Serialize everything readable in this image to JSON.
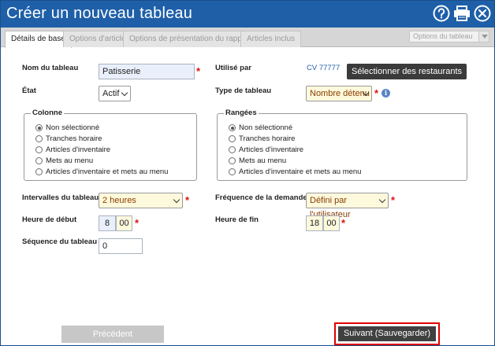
{
  "window": {
    "title": "Créer un nouveau tableau",
    "icons": [
      "help-icon",
      "print-icon",
      "close-icon"
    ]
  },
  "tabs": [
    {
      "label": "Détails de base",
      "active": true
    },
    {
      "label": "Options d'article",
      "active": false
    },
    {
      "label": "Options de présentation du rapport",
      "active": false
    },
    {
      "label": "Articles inclus",
      "active": false
    }
  ],
  "tab_options_select": "Options du tableau",
  "form": {
    "name_label": "Nom du tableau",
    "name_value": "Patisserie",
    "used_by_label": "Utilisé par",
    "used_by_value": "CV 77777",
    "select_restaurants_label": "Sélectionner des restaurants",
    "state_label": "État",
    "state_value": "Actif",
    "table_type_label": "Type de tableau",
    "table_type_value": "Nombre détenu",
    "interval_label": "Intervalles du tableau",
    "interval_value": "2 heures",
    "demand_label": "Fréquence de la demande",
    "demand_value": "Défini par l'utilisateur",
    "start_label": "Heure de début",
    "start_hour": "8",
    "start_min": "00",
    "end_label": "Heure de fin",
    "end_hour": "18",
    "end_min": "00",
    "sequence_label": "Séquence du tableau",
    "sequence_value": "0",
    "required_mark": "*",
    "info_glyph": "i"
  },
  "colonne": {
    "legend": "Colonne",
    "options": [
      "Non sélectionné",
      "Tranches horaire",
      "Articles d'inventaire",
      "Mets au menu",
      "Articles d'inventaire et mets au menu"
    ],
    "selected_index": 0
  },
  "rangees": {
    "legend": "Rangées",
    "options": [
      "Non sélectionné",
      "Tranches horaire",
      "Articles d'inventaire",
      "Mets au menu",
      "Articles d'inventaire et mets au menu"
    ],
    "selected_index": 0
  },
  "footer": {
    "prev_label": "Précédent",
    "next_label": "Suivant (Sauvegarder)"
  },
  "colors": {
    "title_bar": "#1e5fa8",
    "required": "#dd1111",
    "highlight_border": "#e00000"
  }
}
